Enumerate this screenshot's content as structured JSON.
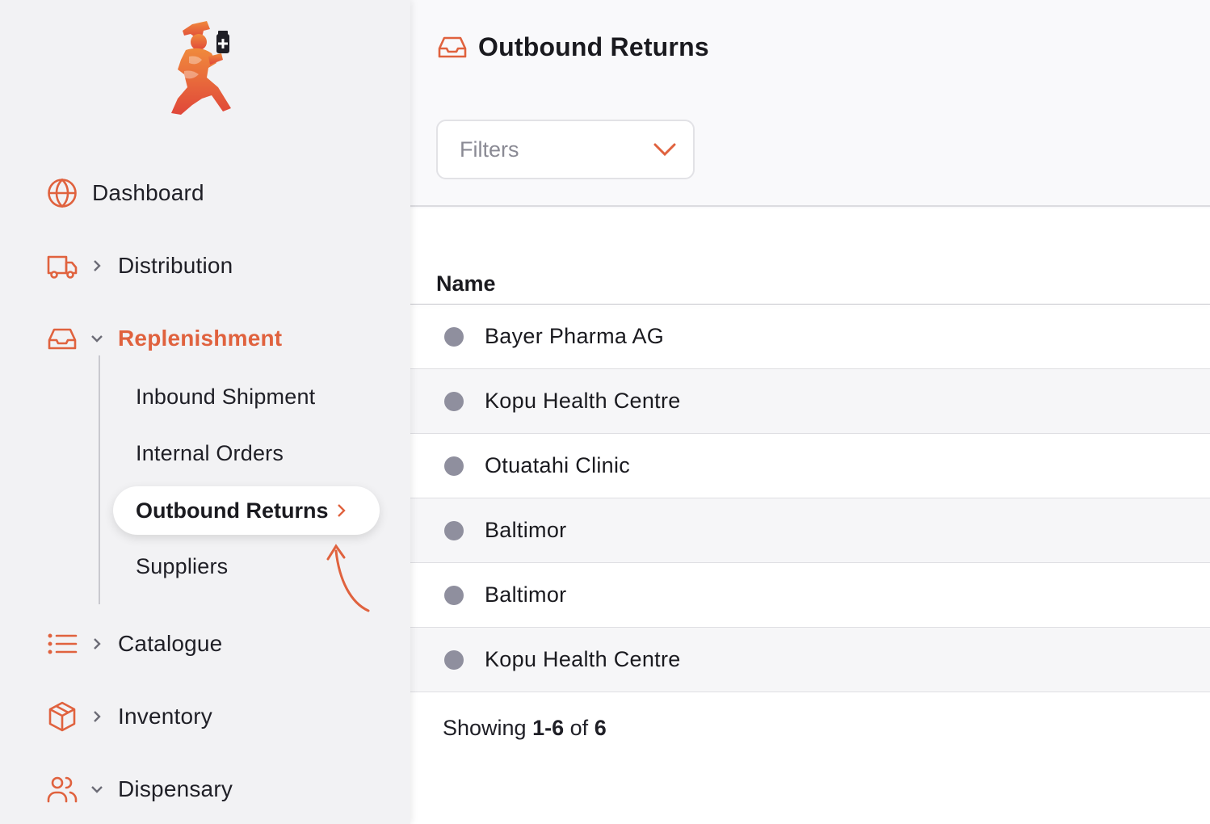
{
  "colors": {
    "accent": "#e0623e",
    "dot": "#8f8f9e"
  },
  "sidebar": {
    "logo": "omsupply-runner-logo",
    "items": [
      {
        "label": "Dashboard",
        "icon": "globe-icon"
      },
      {
        "label": "Distribution",
        "icon": "truck-icon"
      },
      {
        "label": "Replenishment",
        "icon": "inbox-icon",
        "expanded": true,
        "active": true
      },
      {
        "label": "Catalogue",
        "icon": "list-icon"
      },
      {
        "label": "Inventory",
        "icon": "box-icon"
      },
      {
        "label": "Dispensary",
        "icon": "users-icon"
      }
    ],
    "sub_items": [
      "Inbound Shipment",
      "Internal Orders",
      "Outbound Returns",
      "Suppliers"
    ],
    "active_sub": "Outbound Returns"
  },
  "header": {
    "title": "Outbound Returns",
    "filters_label": "Filters"
  },
  "table": {
    "column": "Name",
    "rows": [
      "Bayer Pharma AG",
      "Kopu Health Centre",
      "Otuatahi Clinic",
      "Baltimor",
      "Baltimor",
      "Kopu Health Centre"
    ]
  },
  "pagination": {
    "prefix": "Showing",
    "range": "1-6",
    "of": "of",
    "total": "6"
  }
}
